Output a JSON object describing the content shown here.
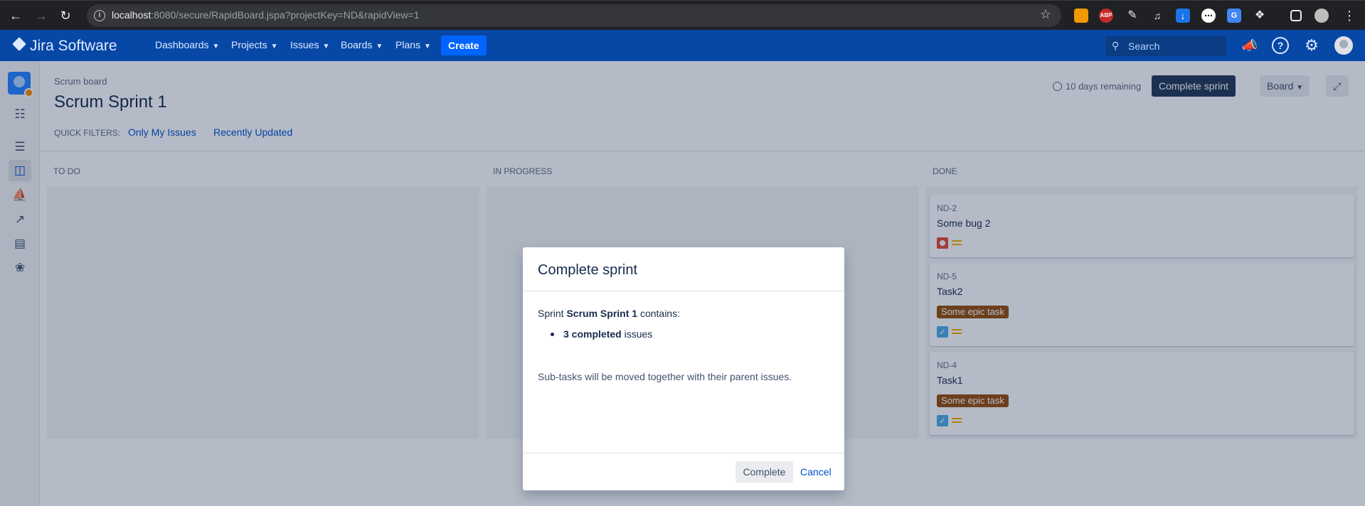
{
  "browser": {
    "url_host": "localhost",
    "url_rest": ":8080/secure/RapidBoard.jspa?projectKey=ND&rapidView=1",
    "extensions": [
      "ABP"
    ]
  },
  "header": {
    "logo": "Jira Software",
    "menu": [
      "Dashboards",
      "Projects",
      "Issues",
      "Boards",
      "Plans"
    ],
    "create": "Create",
    "search_placeholder": "Search"
  },
  "board": {
    "breadcrumb": "Scrum board",
    "title": "Scrum Sprint 1",
    "remaining": "10 days remaining",
    "complete_sprint": "Complete sprint",
    "board_menu": "Board",
    "quick_filters_label": "QUICK FILTERS:",
    "quick_filters": [
      "Only My Issues",
      "Recently Updated"
    ],
    "columns": [
      "TO DO",
      "IN PROGRESS",
      "DONE"
    ],
    "cards": [
      {
        "key": "ND-2",
        "summary": "Some bug 2",
        "epic": "",
        "type": "bug",
        "priority": "medium"
      },
      {
        "key": "ND-5",
        "summary": "Task2",
        "epic": "Some epic task",
        "type": "task",
        "priority": "medium"
      },
      {
        "key": "ND-4",
        "summary": "Task1",
        "epic": "Some epic task",
        "type": "task",
        "priority": "medium"
      }
    ]
  },
  "dialog": {
    "title": "Complete sprint",
    "sprint_prefix": "Sprint",
    "sprint_name": "Scrum Sprint 1",
    "contains": "contains:",
    "completed_count": "3 completed",
    "issues": "issues",
    "note": "Sub-tasks will be moved together with their parent issues.",
    "complete_button": "Complete",
    "cancel_button": "Cancel"
  },
  "colors": {
    "header": "#0747a6",
    "primary": "#0052cc",
    "dark_button": "#253858",
    "epic": "#974f0c",
    "bug": "#e5493a",
    "task": "#4bade8",
    "priority_medium": "#ffab00"
  }
}
